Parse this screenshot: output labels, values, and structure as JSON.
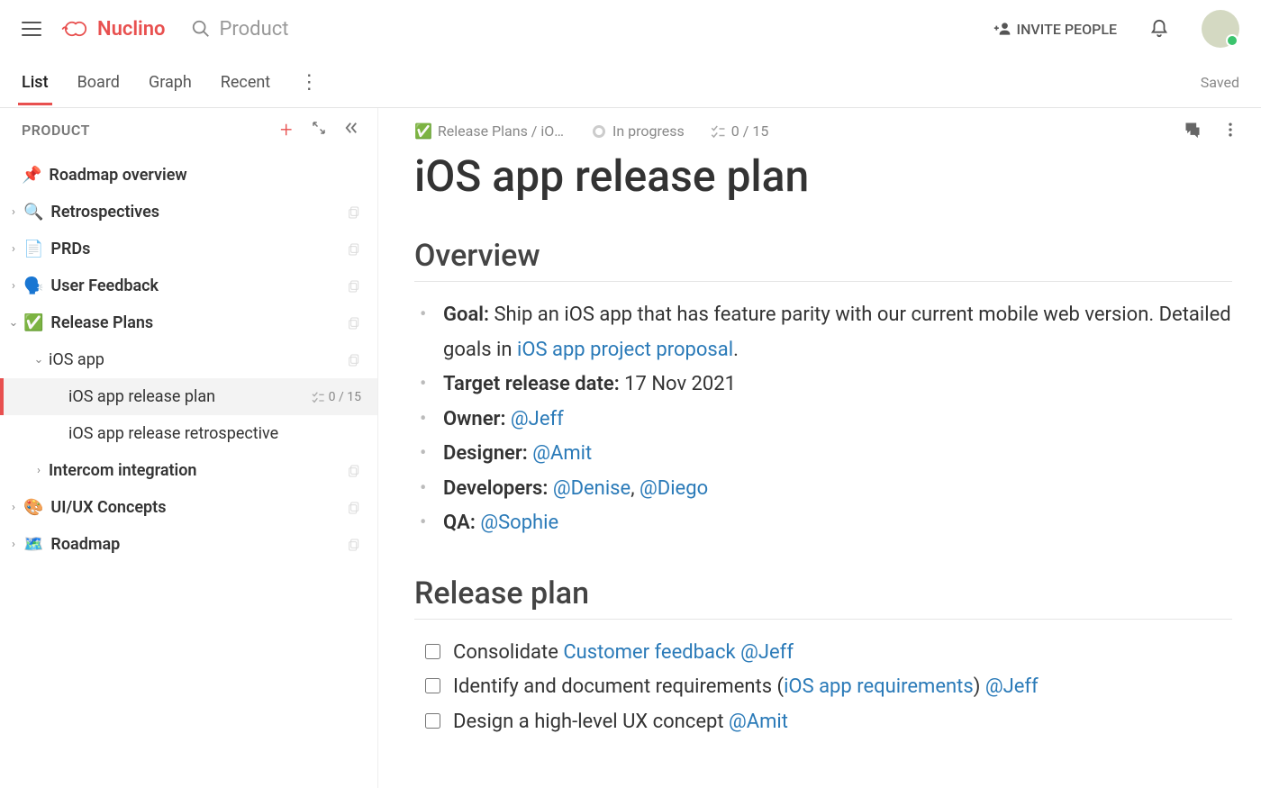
{
  "header": {
    "brand": "Nuclino",
    "workspace": "Product",
    "invite": "INVITE PEOPLE"
  },
  "views": {
    "tabs": [
      "List",
      "Board",
      "Graph",
      "Recent"
    ],
    "active": 0,
    "saved": "Saved"
  },
  "sidebar": {
    "title": "PRODUCT",
    "pinned": {
      "emoji": "📌",
      "label": "Roadmap overview"
    },
    "items": [
      {
        "chev": "›",
        "emoji": "🔍",
        "label": "Retrospectives",
        "bold": true
      },
      {
        "chev": "›",
        "emoji": "📄",
        "label": "PRDs",
        "bold": true
      },
      {
        "chev": "›",
        "emoji": "🗣️",
        "label": "User Feedback",
        "bold": true
      },
      {
        "chev": "⌄",
        "emoji": "✅",
        "label": "Release Plans",
        "bold": true
      },
      {
        "chev": "⌄",
        "emoji": "",
        "label": "iOS app",
        "level": 1,
        "bold": false
      },
      {
        "chev": "",
        "emoji": "",
        "label": "iOS app release plan",
        "level": 2,
        "selected": true,
        "progress": "0 / 15"
      },
      {
        "chev": "",
        "emoji": "",
        "label": "iOS app release retrospective",
        "level": 2
      },
      {
        "chev": "›",
        "emoji": "",
        "label": "Intercom integration",
        "level": 1,
        "bold": true
      },
      {
        "chev": "›",
        "emoji": "🎨",
        "label": "UI/UX Concepts",
        "bold": true
      },
      {
        "chev": "›",
        "emoji": "🗺️",
        "label": "Roadmap",
        "bold": true
      }
    ]
  },
  "doc": {
    "breadcrumb_emoji": "✅",
    "breadcrumb": "Release Plans / iOS…",
    "status": "In progress",
    "progress": "0 / 15",
    "title": "iOS app release plan",
    "overview_heading": "Overview",
    "overview": {
      "goal_label": "Goal:",
      "goal_text_a": " Ship an iOS app that has feature parity with our current mobile web version. Detailed goals in ",
      "goal_link": "iOS app project proposal",
      "goal_text_b": ".",
      "target_label": "Target release date:",
      "target_value": " 17 Nov 2021",
      "owner_label": "Owner:",
      "owner": "@Jeff",
      "designer_label": "Designer:",
      "designer": "@Amit",
      "dev_label": "Developers:",
      "dev1": "@Denise",
      "dev_sep": ", ",
      "dev2": "@Diego",
      "qa_label": "QA:",
      "qa": "@Sophie"
    },
    "plan_heading": "Release plan",
    "tasks": [
      {
        "pre": "Consolidate ",
        "link1": "Customer feedback",
        "mid": " ",
        "mention": "@Jeff"
      },
      {
        "pre": "Identify and document requirements (",
        "link1": "iOS app requirements",
        "mid": ") ",
        "mention": "@Jeff"
      },
      {
        "pre": "Design a high-level UX concept ",
        "link1": "",
        "mid": "",
        "mention": "@Amit"
      }
    ]
  }
}
